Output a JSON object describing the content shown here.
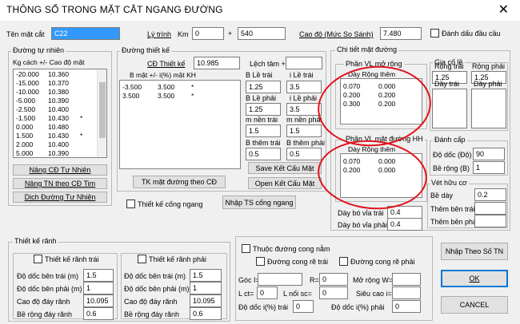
{
  "window": {
    "title": "THÔNG SỐ TRONG MẶT CẮT NGANG ĐƯỜNG",
    "close_icon": "close-icon"
  },
  "header": {
    "ten_mat_cat_label": "Tên mặt cắt",
    "ten_mat_cat_value": "C22",
    "ly_trinh_label": "Lý trình",
    "km_label": "Km",
    "km_value": "0",
    "plus": "+",
    "offset_value": "540",
    "cao_do_label": "Cao độ (Mức So Sánh)",
    "cao_do_value": "7.480",
    "danh_dau_label": "Đánh dấu đầu cầu"
  },
  "tu_nhien": {
    "group": "Đường tự nhiên",
    "col_headers": "Kg cách +/-   Cao độ   mặt",
    "rows": [
      {
        "kc": "-20.000",
        "cd": "10.360",
        "m": ""
      },
      {
        "kc": "-15.000",
        "cd": "10.370",
        "m": ""
      },
      {
        "kc": "-10.000",
        "cd": "10.380",
        "m": ""
      },
      {
        "kc": "-5.000",
        "cd": "10.390",
        "m": ""
      },
      {
        "kc": "-2.500",
        "cd": "10.400",
        "m": ""
      },
      {
        "kc": "-1.500",
        "cd": "10.430",
        "m": "*"
      },
      {
        "kc": "0.000",
        "cd": "10.480",
        "m": ""
      },
      {
        "kc": "1.500",
        "cd": "10.430",
        "m": "*"
      },
      {
        "kc": "2.000",
        "cd": "10.400",
        "m": ""
      },
      {
        "kc": "5.000",
        "cd": "10.390",
        "m": ""
      }
    ],
    "btn_nang_cd": "Nâng CĐ Tự Nhiên",
    "btn_nang_tn": "Nâng TN theo CĐ Tim",
    "btn_dich": "Dịch Đường Tự Nhiên"
  },
  "thiet_ke": {
    "group": "Đường thiết kế",
    "cd_label": "CĐ Thiết kế",
    "cd_value": "10.985",
    "lech_tam_label": "Lệch tâm +/-",
    "lech_tam_value": "",
    "list_headers": "B mặt +/-     i(%)     mặt KH",
    "rows": [
      {
        "b": "-3.500",
        "i": "3.500",
        "m": "*"
      },
      {
        "b": "3.500",
        "i": "3.500",
        "m": "*"
      }
    ],
    "b_le_trai_label": "B Lề trái",
    "b_le_trai": "1.25",
    "i_le_trai_label": "i Lề trái",
    "i_le_trai": "3.5",
    "b_le_phai_label": "B Lề phải",
    "b_le_phai": "1.25",
    "i_le_phai_label": "i Lề phải",
    "i_le_phai": "3.5",
    "m_nen_trai_label": "m nền trái",
    "m_nen_trai": "1.5",
    "m_nen_phai_label": "m nền phải",
    "m_nen_phai": "1.5",
    "b_them_trai_label": "B thêm trái",
    "b_them_trai": "0.5",
    "b_them_phai_label": "B thêm phải",
    "b_them_phai": "0.5",
    "btn_save": "Save Kết Cấu Mặt",
    "btn_open": "Open Kết Cấu Mặt",
    "btn_tk": "TK mặt đường theo CĐ"
  },
  "chi_tiet": {
    "group": "Chi tiết mặt đường",
    "pvl_mo_rong": {
      "group": "Phần VL mở rộng",
      "headers": "Dày      Rộng thêm",
      "rows": [
        [
          "0.070",
          "0.000"
        ],
        [
          "0.200",
          "0.200"
        ],
        [
          "0.300",
          "0.200"
        ]
      ]
    },
    "pvl_hh": {
      "group": "Phần VL mặt đường HH",
      "headers": "Dày      Rộng thêm",
      "rows": [
        [
          "0.070",
          "0.000"
        ],
        [
          "0.200",
          "0.000"
        ]
      ]
    },
    "day_bo_via_trai_label": "Dày bó vỉa trái",
    "day_bo_via_trai": "0.4",
    "day_bo_via_phai_label": "Dày bó vỉa phải",
    "day_bo_via_phai": "0.4"
  },
  "gia_co_le": {
    "group": "Gia cố lề",
    "rong_trai_label": "Rộng trái",
    "rong_trai": "1.25",
    "rong_phai_label": "Rộng phải",
    "rong_phai": "1.25",
    "day_trai_label": "Dầy trái",
    "day_phai_label": "Dầy phải"
  },
  "danh_cap": {
    "group": "Đánh cấp",
    "do_doc_label": "Độ dốc (Độ)",
    "do_doc": "90",
    "be_rong_label": "Bề rộng (B)",
    "be_rong": "1"
  },
  "vet_huu_co": {
    "group": "Vét hữu cơ",
    "be_day_label": "Bề dày",
    "be_day": "0.2",
    "them_ben_trai_label": "Thêm bên trái",
    "them_ben_phai_label": "Thêm bên phải"
  },
  "cong": {
    "thiet_ke_cong_label": "Thiết kế cống ngang",
    "btn_nhap_ts": "Nhập TS cống ngang"
  },
  "ranh": {
    "group": "Thiết kế rãnh",
    "trai_cb": "Thiết kế rãnh trái",
    "phai_cb": "Thiết kế rãnh phải",
    "trai": {
      "do_doc_ben_trai_label": "Độ dốc bên trái (m)",
      "do_doc_ben_trai": "1.5",
      "do_doc_ben_phai_label": "Độ dốc bên phải (m)",
      "do_doc_ben_phai": "1",
      "cao_do_day_label": "Cao độ đáy rãnh",
      "cao_do_day": "10.095",
      "be_rong_label": "Bề rộng đáy rãnh",
      "be_rong": "0.6"
    },
    "phai": {
      "do_doc_ben_trai_label": "Độ dốc bên trái (m)",
      "do_doc_ben_trai": "1.5",
      "do_doc_ben_phai_label": "Độ dốc bên phải (m)",
      "do_doc_ben_phai": "1",
      "cao_do_day_label": "Cao độ đáy rãnh",
      "cao_do_day": "10.095",
      "be_rong_label": "Bề rộng đáy rãnh",
      "be_rong": "0.6"
    }
  },
  "cong_nam": {
    "cb": "Thuộc đường cong nằm",
    "cong_re_trai": "Đường cong rẽ trái",
    "cong_re_phai": "Đường cong rẽ phải",
    "goc_label": "Góc I=",
    "r_label": "R=",
    "r_value": "0",
    "mo_rong_label": "Mở rộng W=",
    "lct_label": "L ct=",
    "lct_value": "0",
    "lnoi_label": "L nối sc=",
    "lnoi_value": "0",
    "sieu_cao_label": "Siêu cao i=",
    "do_doc_trai_label": "Độ dốc i(%) trái",
    "do_doc_trai": "0",
    "do_doc_phai_label": "Độ dốc i(%) phải",
    "do_doc_phai": "0"
  },
  "buttons": {
    "nhap_theo": "Nhập Theo Số TN",
    "ok": "OK",
    "cancel": "CANCEL"
  }
}
